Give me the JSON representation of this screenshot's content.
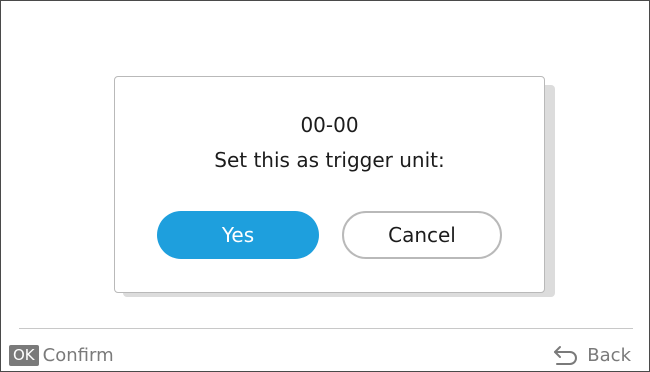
{
  "dialog": {
    "unit_id": "00-00",
    "message": "Set this as trigger unit:",
    "yes_label": "Yes",
    "cancel_label": "Cancel"
  },
  "footer": {
    "ok_badge": "OK",
    "confirm_label": "Confirm",
    "back_label": "Back",
    "back_icon": "return-arrow-icon"
  },
  "colors": {
    "accent": "#1e9fdd",
    "footer_text": "#7a7a7a",
    "border": "#b9b9b9"
  }
}
